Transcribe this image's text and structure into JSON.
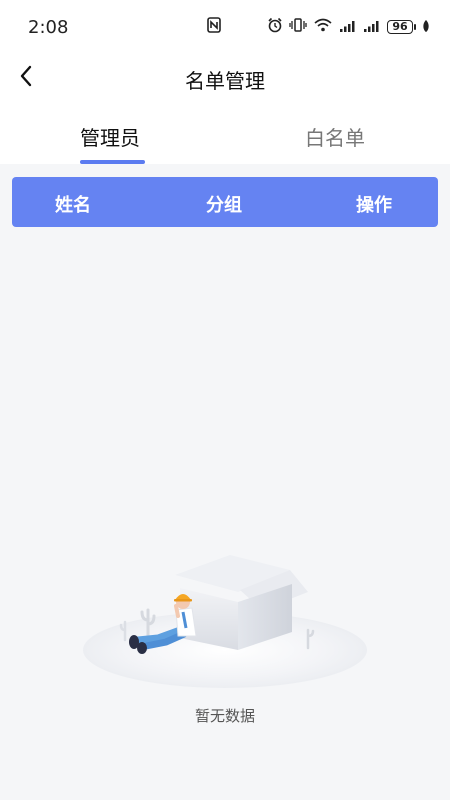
{
  "status_bar": {
    "time": "2:08",
    "battery": "96",
    "icons": [
      "nfc-icon",
      "alarm-icon",
      "vibrate-icon",
      "wifi-icon",
      "signal-icon",
      "signal-icon",
      "battery-icon",
      "leaf-icon"
    ]
  },
  "nav": {
    "title": "名单管理",
    "back_icon": "chevron-left-icon"
  },
  "tabs": {
    "items": [
      {
        "label": "管理员",
        "active": true
      },
      {
        "label": "白名单",
        "active": false
      }
    ],
    "accent": "#5b7bf0"
  },
  "table": {
    "header_color": "#6583f2",
    "columns": [
      "姓名",
      "分组",
      "操作"
    ],
    "rows": []
  },
  "empty_state": {
    "text": "暂无数据",
    "illustration": "empty-box-illustration"
  }
}
